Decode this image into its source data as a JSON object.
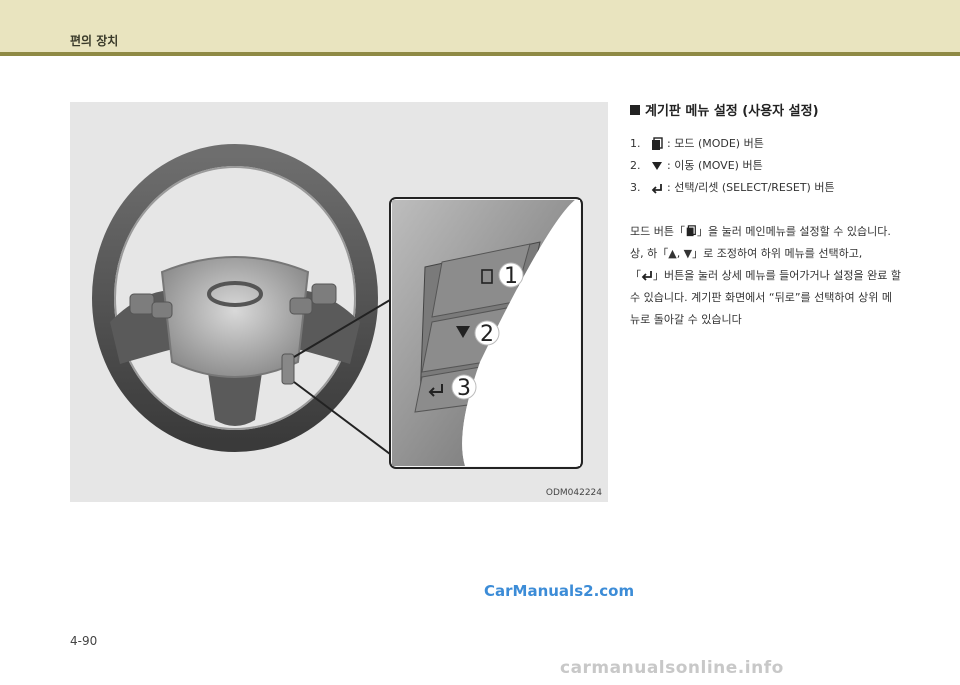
{
  "header": {
    "chapter_title": "편의 장치"
  },
  "figure": {
    "code": "ODM042224",
    "callouts": [
      "1",
      "2",
      "3"
    ]
  },
  "section": {
    "title": "계기판 메뉴 설정 (사용자 설정)",
    "buttons": [
      {
        "number": "1.",
        "icon": "mode-button-icon",
        "text": ": 모드 (MODE) 버튼"
      },
      {
        "number": "2.",
        "icon": "move-down-triangle-icon",
        "text": ": 이동 (MOVE) 버튼"
      },
      {
        "number": "3.",
        "icon": "select-reset-enter-icon",
        "text": ": 선택/리셋 (SELECT/RESET) 버튼"
      }
    ],
    "paragraph1": {
      "pre": "모드 버튼「",
      "post": "」을 눌러 메인메뉴를 설정할 수 있습니다."
    },
    "paragraph2": {
      "line1": "상, 하「▲, ▼」로 조정하여 하위 메뉴를 선택하고,",
      "pre": "「",
      "post": "」버튼을 눌러 상세 메뉴를 들어가거나 설정을 완료 할 수 있습니다. 계기판 화면에서 “뒤로”를 선택하여 상위 메뉴로 돌아갈 수 있습니다"
    }
  },
  "watermark": "CarManuals2.com",
  "page_number": "4-90",
  "footer_watermark": "carmanualsonline.info"
}
